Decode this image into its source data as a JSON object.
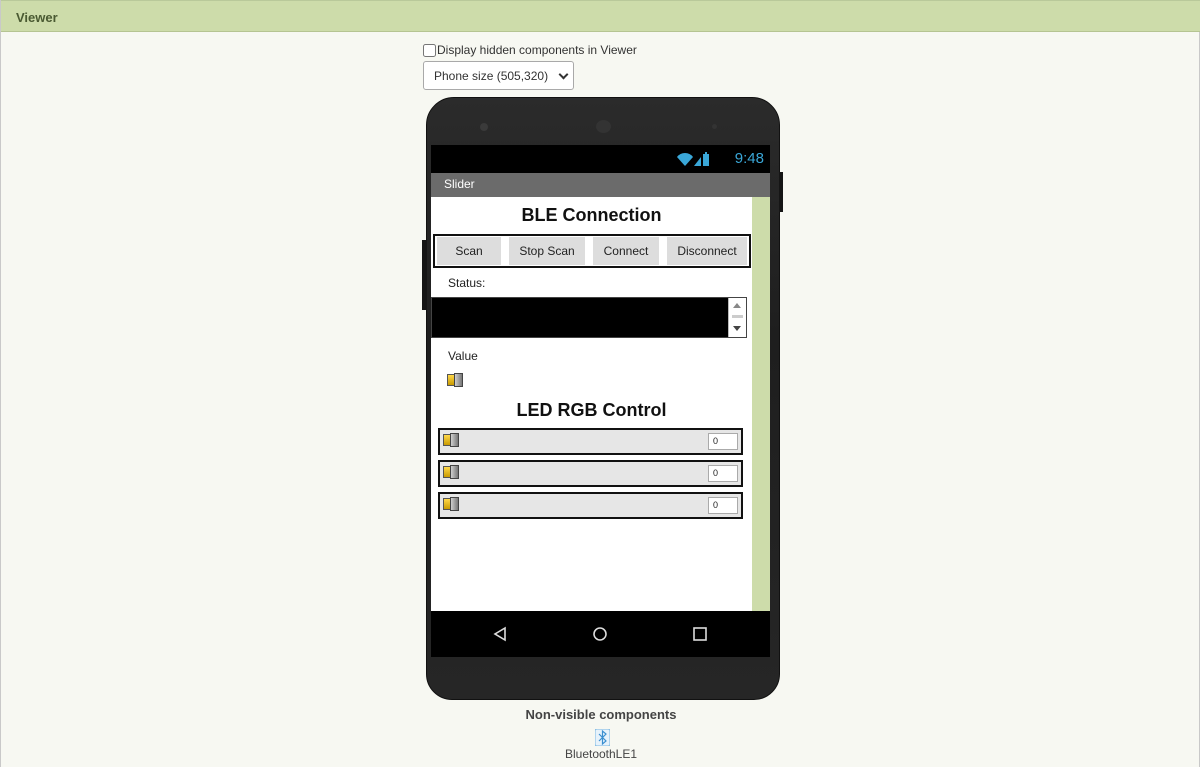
{
  "viewer": {
    "title": "Viewer"
  },
  "options": {
    "hidden_label": "Display hidden components in Viewer",
    "hidden_checked": false,
    "size_select": "Phone size (505,320)"
  },
  "phone": {
    "time": "9:48",
    "screen_title": "Slider",
    "ble_heading": "BLE Connection",
    "buttons": [
      "Scan",
      "Stop Scan",
      "Connect",
      "Disconnect"
    ],
    "status_label": "Status:",
    "value_label": "Value",
    "led_heading": "LED RGB Control",
    "sliders": [
      {
        "value": "0"
      },
      {
        "value": "0"
      },
      {
        "value": "0"
      }
    ]
  },
  "nonvisible": {
    "title": "Non-visible components",
    "items": [
      {
        "name": "BluetoothLE1",
        "icon": "bluetooth-icon"
      }
    ]
  },
  "colors": {
    "header_bg": "#cddcaa",
    "accent_blue": "#3aa7d8",
    "titlebar": "#6b6b6b"
  }
}
